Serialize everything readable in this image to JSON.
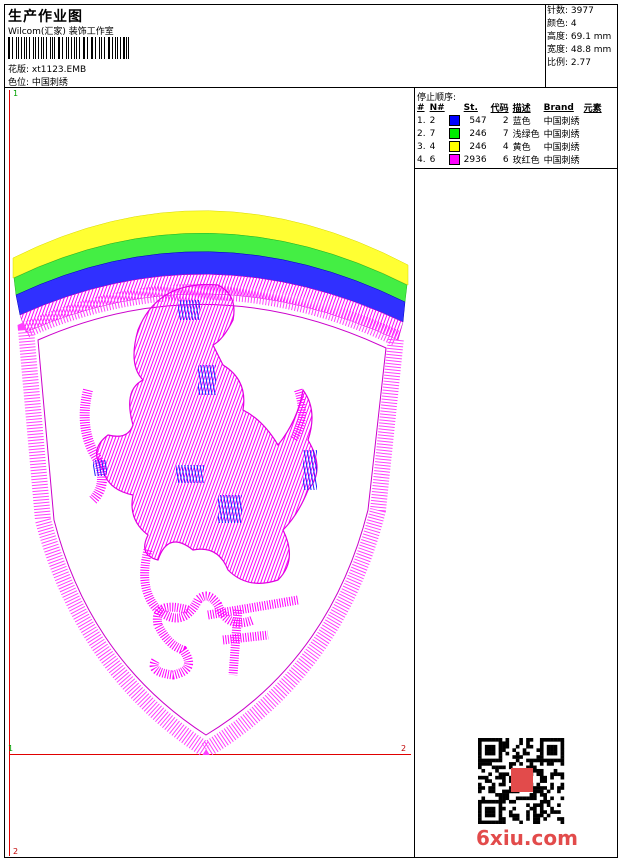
{
  "header": {
    "title": "生产作业图",
    "company": "Wilcom(汇家) 装饰工作室",
    "design_file_label": "花版: xt1123.EMB",
    "color_label": "色位: 中国刺绣"
  },
  "stats": {
    "stitches": "针数: 3977",
    "colors": "颜色: 4",
    "height": "高度: 69.1 mm",
    "width": "宽度: 48.8 mm",
    "scale": "比例: 2.77"
  },
  "stop_sequence": {
    "title": "停止顺序:",
    "headers": [
      "#",
      "N#",
      "St.",
      "代码",
      "描述",
      "Brand",
      "元素"
    ],
    "rows": [
      {
        "idx": "1.",
        "n": "2",
        "swatch": "#0000ff",
        "st": "547",
        "code": "2",
        "desc": "蓝色",
        "brand": "中国刺绣"
      },
      {
        "idx": "2.",
        "n": "7",
        "swatch": "#00ee00",
        "st": "246",
        "code": "7",
        "desc": "浅绿色",
        "brand": "中国刺绣"
      },
      {
        "idx": "3.",
        "n": "4",
        "swatch": "#ffff00",
        "st": "246",
        "code": "4",
        "desc": "黄色",
        "brand": "中国刺绣"
      },
      {
        "idx": "4.",
        "n": "6",
        "swatch": "#ff00ff",
        "st": "2936",
        "code": "6",
        "desc": "玫红色",
        "brand": "中国刺绣"
      }
    ]
  },
  "axes": {
    "top_left": "1",
    "mid_left": "1",
    "mid_right": "2",
    "bottom_left": "2"
  },
  "watermark": "6xiu.com"
}
